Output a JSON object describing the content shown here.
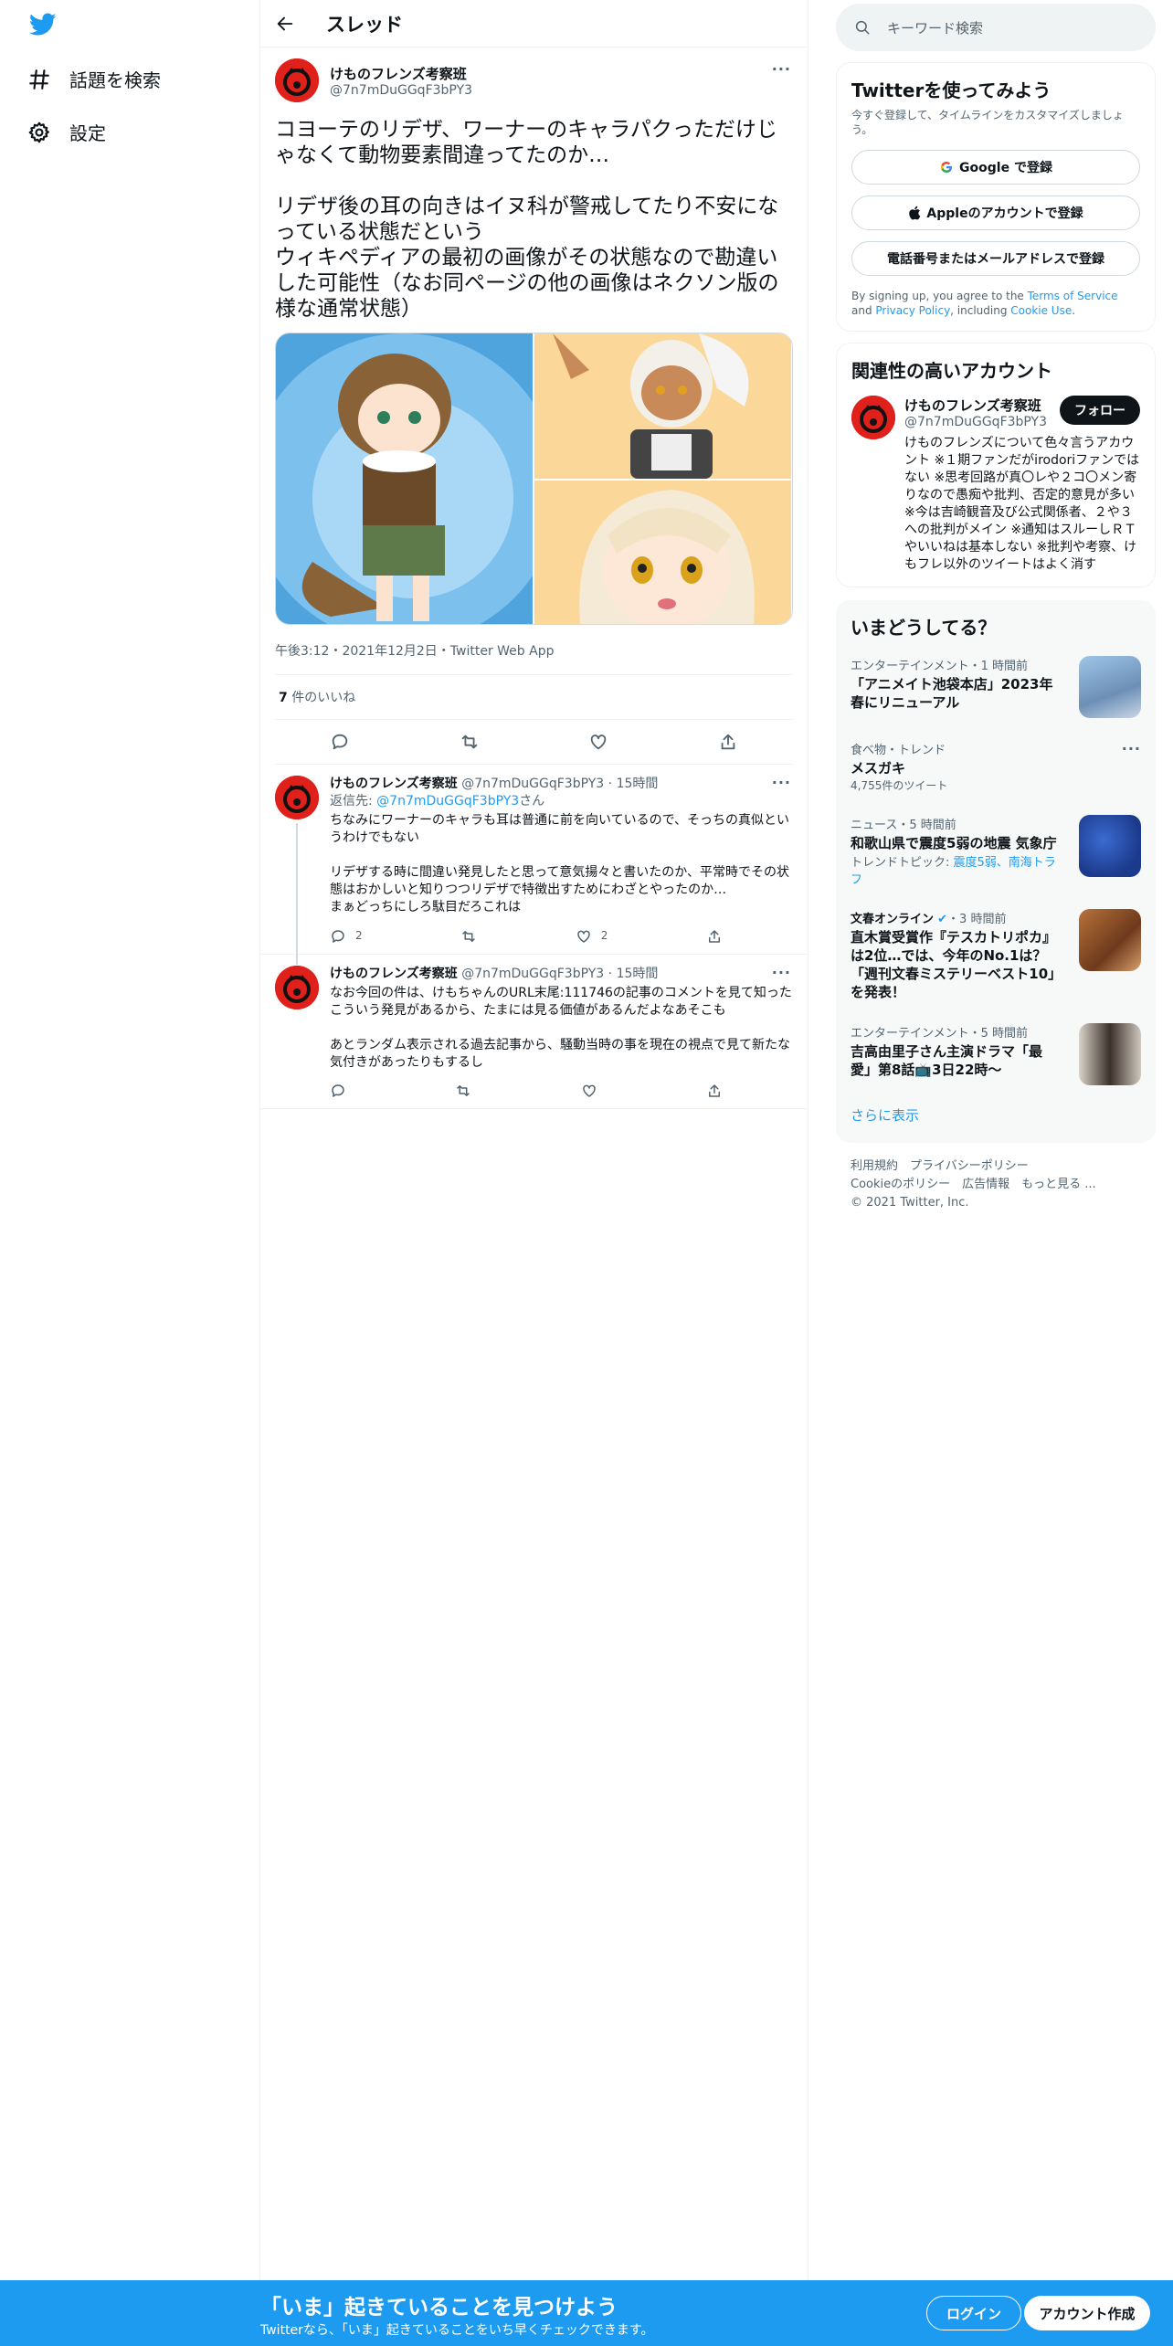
{
  "nav": {
    "explore_label": "話題を検索",
    "settings_label": "設定"
  },
  "header": {
    "title": "スレッド"
  },
  "tweet": {
    "author_name": "けものフレンズ考察班",
    "author_handle": "@7n7mDuGGqF3bPY3",
    "text": "コヨーテのリデザ、ワーナーのキャラパクっただけじゃなくて動物要素間違ってたのか…\n\nリデザ後の耳の向きはイヌ科が警戒してたり不安になっている状態だという\nウィキペディアの最初の画像がその状態なので勘違いした可能性（なお同ページの他の画像はネクソン版の様な通常状態）",
    "timestamp": "午後3:12・2021年12月2日・Twitter Web App",
    "likes_count": "7",
    "likes_label": " 件のいいね"
  },
  "replies": [
    {
      "name": "けものフレンズ考察班",
      "handle": "@7n7mDuGGqF3bPY3",
      "time": "15時間",
      "reply_to_prefix": "返信先: ",
      "reply_to_handle": "@7n7mDuGGqF3bPY3",
      "reply_to_suffix": "さん",
      "text": "ちなみにワーナーのキャラも耳は普通に前を向いているので、そっちの真似というわけでもない\n\nリデザする時に間違い発見したと思って意気揚々と書いたのか、平常時でその状態はおかしいと知りつつリデザで特徴出すためにわざとやったのか…\nまぁどっちにしろ駄目だろこれは",
      "reply_count": "2",
      "like_count": "2"
    },
    {
      "name": "けものフレンズ考察班",
      "handle": "@7n7mDuGGqF3bPY3",
      "time": "15時間",
      "text": "なお今回の件は、けもちゃんのURL末尾:111746の記事のコメントを見て知った\nこういう発見があるから、たまには見る価値があるんだよなあそこも\n\nあとランダム表示される過去記事から、騒動当時の事を現在の視点で見て新たな気付きがあったりもするし"
    }
  ],
  "search": {
    "placeholder": "キーワード検索"
  },
  "signup": {
    "title": "Twitterを使ってみよう",
    "subtitle": "今すぐ登録して、タイムラインをカスタマイズしましょう。",
    "google": "Google で登録",
    "apple": "Appleのアカウントで登録",
    "phone": "電話番号またはメールアドレスで登録",
    "terms_pre": "By signing up, you agree to the ",
    "terms_link": "Terms of Service",
    "terms_and": " and ",
    "privacy_link": "Privacy Policy",
    "terms_including": ", including ",
    "cookie_link": "Cookie Use",
    "terms_end": "."
  },
  "related": {
    "title": "関連性の高いアカウント",
    "name": "けものフレンズ考察班",
    "handle": "@7n7mDuGGqF3bPY3",
    "follow": "フォロー",
    "bio": "けものフレンズについて色々言うアカウント ※１期ファンだがirodoriファンではない ※思考回路が真〇レや２コ〇メン寄りなので愚痴や批判、否定的意見が多い ※今は吉崎観音及び公式関係者、２や３への批判がメイン ※通知はスルーしＲＴやいいねは基本しない ※批判や考察、けもフレ以外のツイートはよく消す"
  },
  "trends": {
    "title": "いまどうしてる？",
    "items": [
      {
        "meta": "エンターテインメント・1 時間前",
        "title": "「アニメイト池袋本店」2023年春にリニューアル"
      },
      {
        "meta": "食べ物・トレンド",
        "title": "メスガキ",
        "count": "4,755件のツイート"
      },
      {
        "meta": "ニュース・5 時間前",
        "title": "和歌山県で震度5弱の地震 気象庁",
        "topic_label": "トレンドトピック: ",
        "topic": "震度5弱、南海トラフ"
      },
      {
        "meta": "文春オンライン",
        "meta_time": "・3 時間前",
        "title": "直木賞受賞作『テスカトリポカ』は2位…では、今年のNo.1は？「週刊文春ミステリーベスト10」を発表！"
      },
      {
        "meta": "エンターテインメント・5 時間前",
        "title": "吉高由里子さん主演ドラマ「最愛」第8話📺3日22時〜"
      }
    ],
    "show_more": "さらに表示"
  },
  "footer": {
    "links1": "利用規約　プライバシーポリシー",
    "links2": "Cookieのポリシー　広告情報　もっと見る ...",
    "copyright": "© 2021 Twitter, Inc."
  },
  "bottom": {
    "title": "「いま」起きていることを見つけよう",
    "subtitle": "Twitterなら、「いま」起きていることをいち早くチェックできます。",
    "login": "ログイン",
    "signup": "アカウント作成"
  },
  "colors": {
    "accent": "#1d9bf0",
    "text": "#0f1419",
    "muted": "#536471"
  }
}
